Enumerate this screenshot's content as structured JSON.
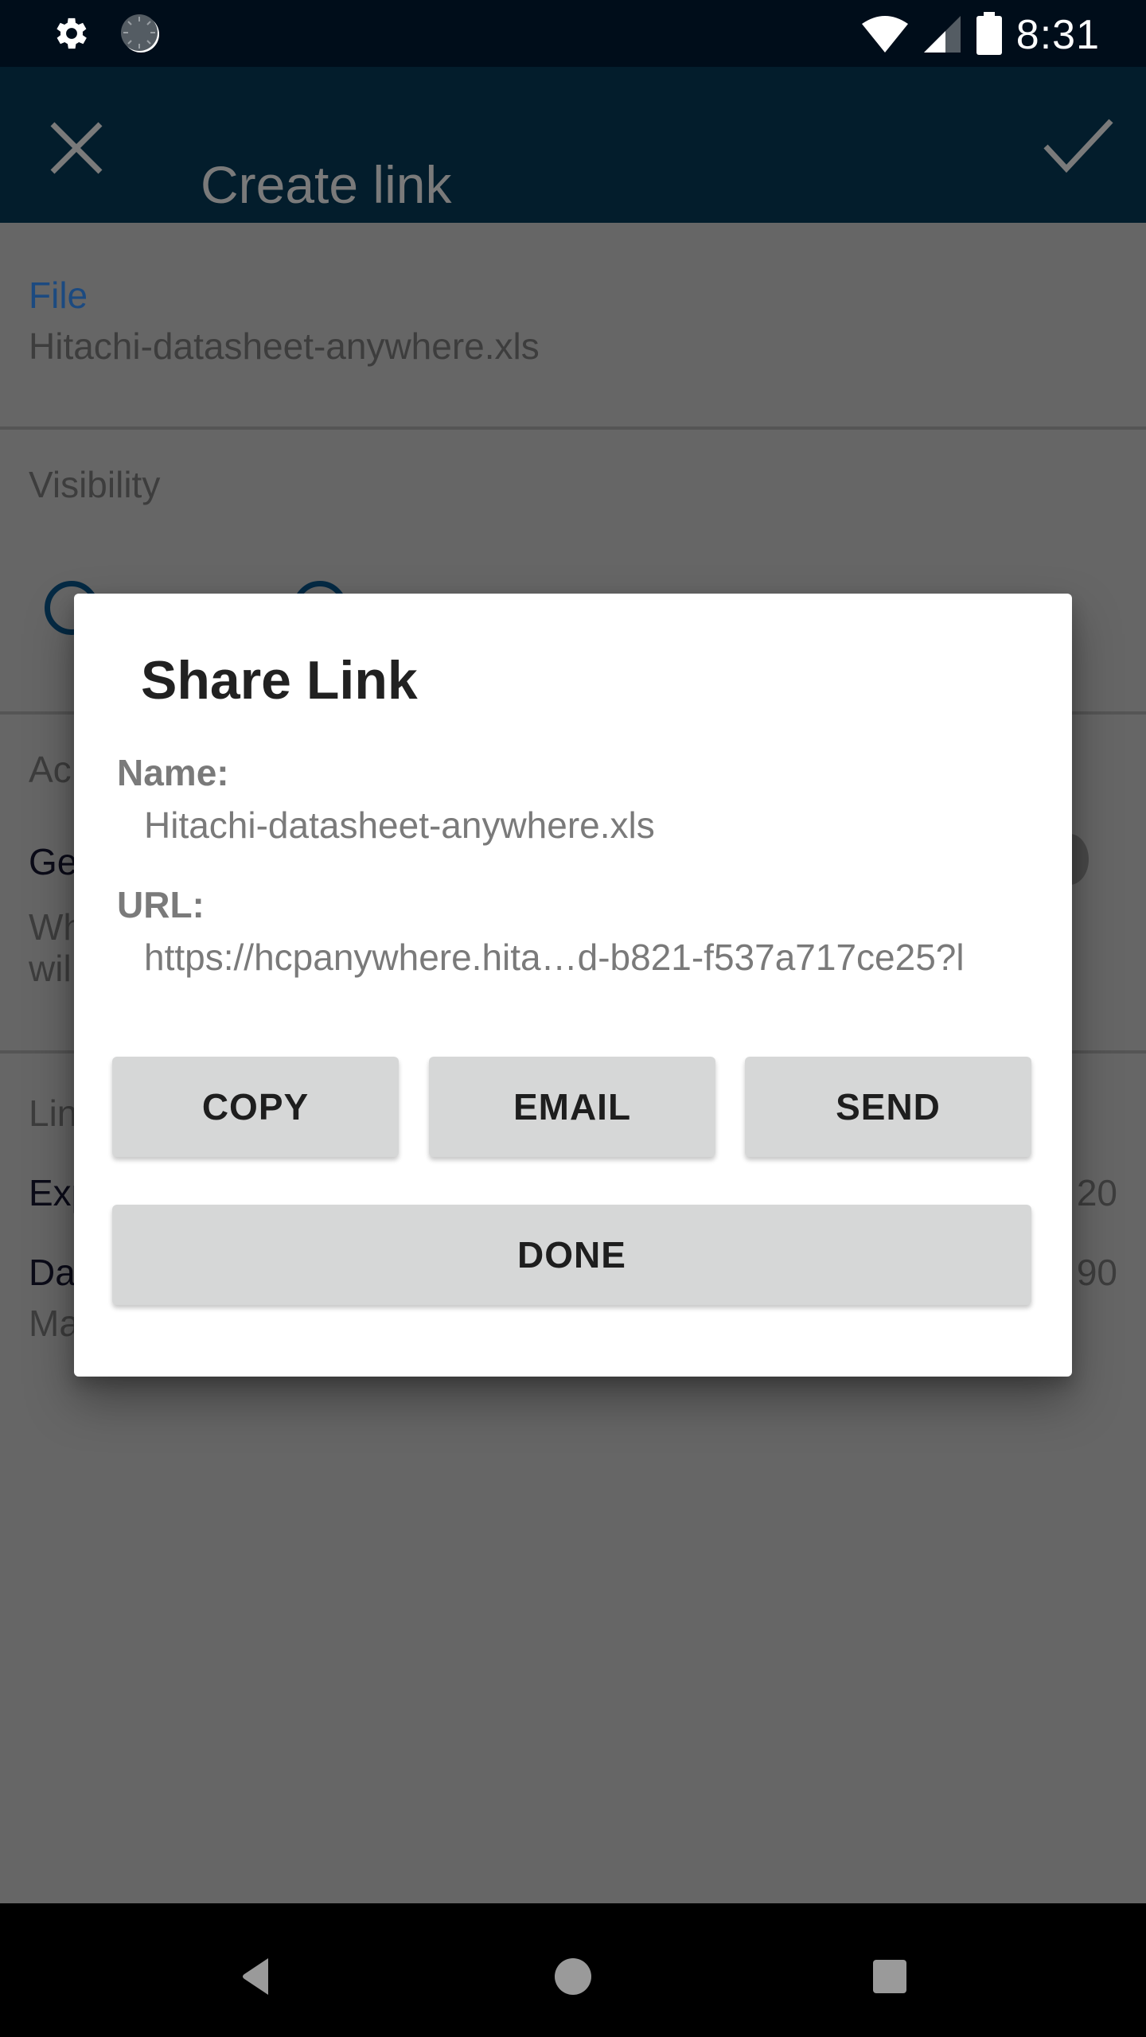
{
  "status_bar": {
    "time": "8:31",
    "left_icons": [
      "gear-icon",
      "sync-icon"
    ],
    "right_icons": [
      "wifi-icon",
      "signal-icon",
      "battery-icon"
    ]
  },
  "app_bar": {
    "title": "Create link",
    "close_icon": "close-icon",
    "confirm_icon": "check-icon"
  },
  "background": {
    "file_label": "File",
    "file_value": "Hitachi-datasheet-anywhere.xls",
    "visibility_label": "Visibility",
    "access_label_partial": "Ac",
    "generate_partial": "Ge",
    "generate_desc_line1_partial": "Wh",
    "generate_desc_line2_partial": "wil",
    "limits_label_partial": "Lin",
    "expiry_partial": "Exp",
    "expiry_value_partial": "20",
    "days_partial": "Da",
    "days_value_partial": "90",
    "max_partial": "Ma"
  },
  "dialog": {
    "title": "Share Link",
    "name_label": "Name:",
    "name_value": "Hitachi-datasheet-anywhere.xls",
    "url_label": "URL:",
    "url_value": "https://hcpanywhere.hita…d-b821-f537a717ce25?l",
    "buttons": {
      "copy": "COPY",
      "email": "EMAIL",
      "send": "SEND",
      "done": "DONE"
    }
  },
  "nav_bar": {
    "back": "back-icon",
    "home": "home-icon",
    "recents": "recents-icon"
  },
  "colors": {
    "status_bar": "#000d1a",
    "app_bar": "#031d2c",
    "scrim": "#666666",
    "accent_blue": "#1c4a80",
    "button_bg": "#d6d7d7"
  }
}
